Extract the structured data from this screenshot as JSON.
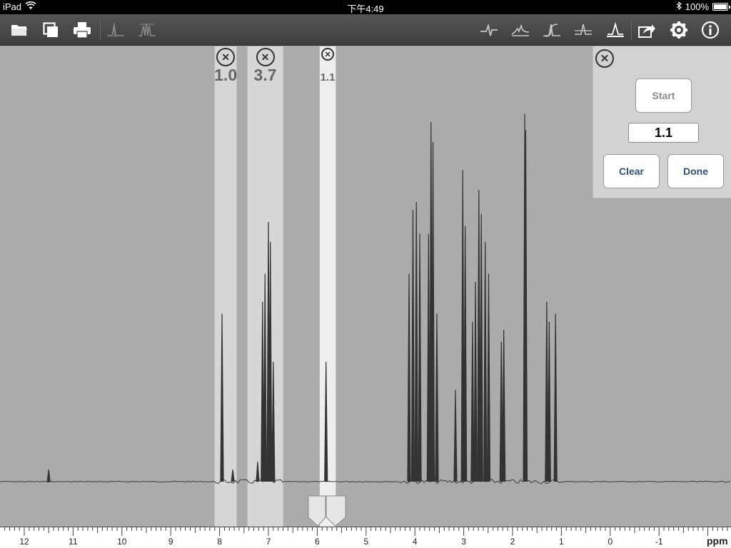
{
  "status": {
    "device": "iPad",
    "time": "下午4:49",
    "battery": "100%"
  },
  "toolbar": {
    "left": [
      "folder-icon",
      "copy-icon",
      "print-icon",
      "peak-pick-icon",
      "multiplet-icon"
    ],
    "right": [
      "phase-icon",
      "baseline-icon",
      "integrate-icon",
      "peak-icon",
      "integral-region-icon",
      "share-icon",
      "gear-icon",
      "info-icon"
    ]
  },
  "integrals": [
    {
      "label": "1.0",
      "from": 8.1,
      "to": 7.65,
      "size": "large"
    },
    {
      "label": "3.7",
      "from": 7.43,
      "to": 6.7,
      "size": "large"
    },
    {
      "label": "1.1",
      "from": 5.95,
      "to": 5.62,
      "size": "small"
    }
  ],
  "panel": {
    "start_label": "Start",
    "value": "1.1",
    "clear_label": "Clear",
    "done_label": "Done"
  },
  "axis": {
    "unit": "ppm",
    "ticks": [
      "12",
      "11",
      "10",
      "9",
      "8",
      "7",
      "6",
      "5",
      "4",
      "3",
      "2",
      "1",
      "0",
      "-1"
    ]
  },
  "chart_data": {
    "type": "line",
    "xlabel": "ppm",
    "xlim": [
      12.5,
      -2.5
    ],
    "reversed_x": true,
    "peaks": [
      {
        "ppm": 11.5,
        "height": 0.03
      },
      {
        "ppm": 7.95,
        "height": 0.42
      },
      {
        "ppm": 7.73,
        "height": 0.03
      },
      {
        "ppm": 7.22,
        "height": 0.05
      },
      {
        "ppm": 7.12,
        "height": 0.45
      },
      {
        "ppm": 7.07,
        "height": 0.52
      },
      {
        "ppm": 7.0,
        "height": 0.65
      },
      {
        "ppm": 6.96,
        "height": 0.6
      },
      {
        "ppm": 6.9,
        "height": 0.3
      },
      {
        "ppm": 5.82,
        "height": 0.3
      },
      {
        "ppm": 4.12,
        "height": 0.52
      },
      {
        "ppm": 4.04,
        "height": 0.68
      },
      {
        "ppm": 3.97,
        "height": 0.7
      },
      {
        "ppm": 3.9,
        "height": 0.62
      },
      {
        "ppm": 3.72,
        "height": 0.62
      },
      {
        "ppm": 3.67,
        "height": 0.9
      },
      {
        "ppm": 3.63,
        "height": 0.85
      },
      {
        "ppm": 3.55,
        "height": 0.42
      },
      {
        "ppm": 3.17,
        "height": 0.23
      },
      {
        "ppm": 3.02,
        "height": 0.78
      },
      {
        "ppm": 2.97,
        "height": 0.64
      },
      {
        "ppm": 2.82,
        "height": 0.4
      },
      {
        "ppm": 2.76,
        "height": 0.5
      },
      {
        "ppm": 2.69,
        "height": 0.73
      },
      {
        "ppm": 2.64,
        "height": 0.67
      },
      {
        "ppm": 2.56,
        "height": 0.6
      },
      {
        "ppm": 2.49,
        "height": 0.52
      },
      {
        "ppm": 2.23,
        "height": 0.35
      },
      {
        "ppm": 2.18,
        "height": 0.38
      },
      {
        "ppm": 1.75,
        "height": 0.92
      },
      {
        "ppm": 1.73,
        "height": 0.88
      },
      {
        "ppm": 1.3,
        "height": 0.45
      },
      {
        "ppm": 1.25,
        "height": 0.4
      },
      {
        "ppm": 1.12,
        "height": 0.42
      }
    ]
  }
}
